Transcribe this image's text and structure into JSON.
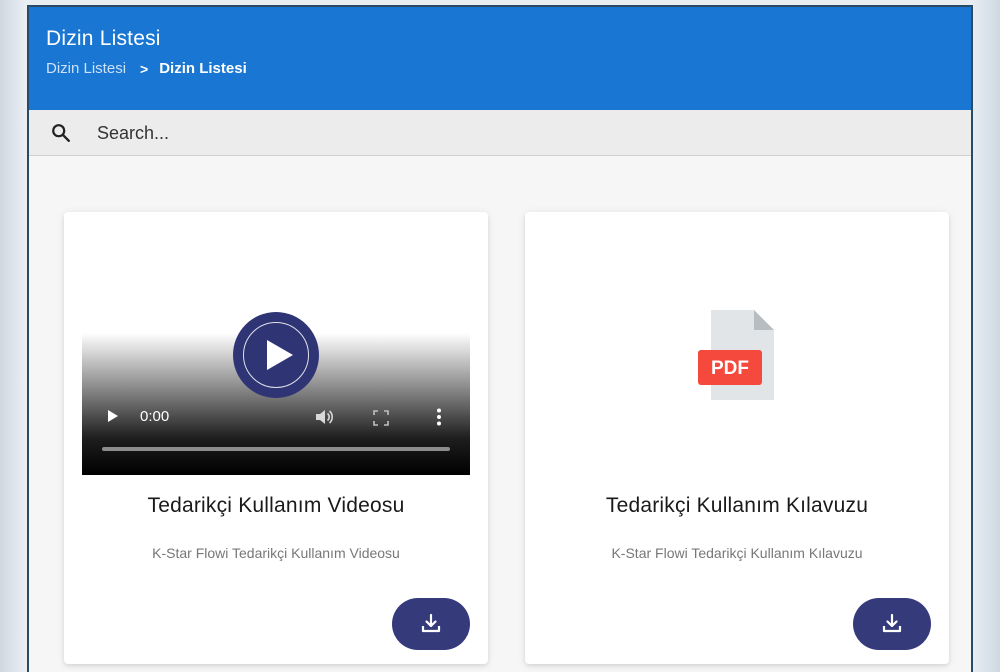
{
  "header": {
    "title": "Dizin Listesi",
    "breadcrumb": {
      "parent": "Dizin Listesi",
      "separator": ">",
      "current": "Dizin Listesi"
    }
  },
  "search": {
    "placeholder": "Search...",
    "icon": "search-icon"
  },
  "cards": [
    {
      "type": "video",
      "title": "Tedarikçi Kullanım Videosu",
      "description": "K-Star Flowi Tedarikçi Kullanım Videosu",
      "player": {
        "time": "0:00",
        "progress": 0
      },
      "download_icon": "download-icon"
    },
    {
      "type": "pdf",
      "title": "Tedarikçi Kullanım Kılavuzu",
      "description": "K-Star Flowi Tedarikçi Kullanım Kılavuzu",
      "file_badge": "PDF",
      "download_icon": "download-icon"
    }
  ],
  "colors": {
    "header_bg": "#1976d2",
    "accent": "#343a7a",
    "pdf_badge": "#f4493c"
  }
}
